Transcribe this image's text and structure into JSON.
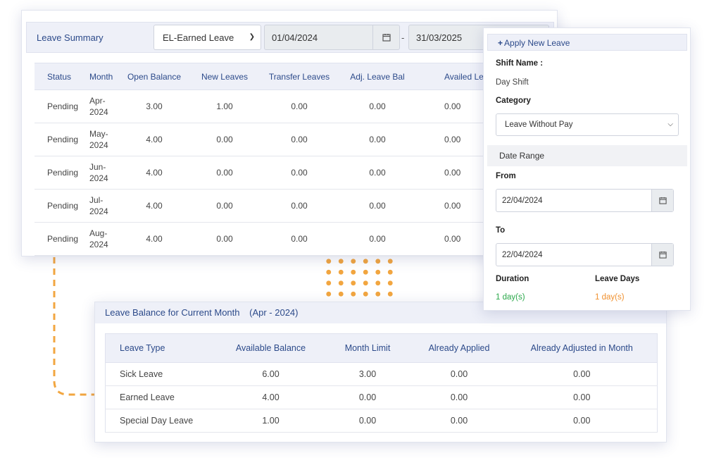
{
  "colors": {
    "accent": "#2c4a8a",
    "header_bg": "#eef0f8",
    "dash": "#f2a640",
    "green": "#2aa84a",
    "orange": "#f0902e"
  },
  "summary": {
    "title": "Leave Summary",
    "leave_type": "EL-Earned Leave",
    "date_from": "01/04/2024",
    "separator": "-",
    "date_to": "31/03/2025",
    "columns": [
      "Status",
      "Month",
      "Open Balance",
      "New Leaves",
      "Transfer Leaves",
      "Adj. Leave Bal",
      "Availed Lea"
    ],
    "rows": [
      {
        "status": "Pending",
        "month_a": "Apr-",
        "month_b": "2024",
        "open": "3.00",
        "new": "1.00",
        "transfer": "0.00",
        "adj": "0.00",
        "availed": "0.00"
      },
      {
        "status": "Pending",
        "month_a": "May-",
        "month_b": "2024",
        "open": "4.00",
        "new": "0.00",
        "transfer": "0.00",
        "adj": "0.00",
        "availed": "0.00"
      },
      {
        "status": "Pending",
        "month_a": "Jun-",
        "month_b": "2024",
        "open": "4.00",
        "new": "0.00",
        "transfer": "0.00",
        "adj": "0.00",
        "availed": "0.00"
      },
      {
        "status": "Pending",
        "month_a": "Jul-",
        "month_b": "2024",
        "open": "4.00",
        "new": "0.00",
        "transfer": "0.00",
        "adj": "0.00",
        "availed": "0.00"
      },
      {
        "status": "Pending",
        "month_a": "Aug-",
        "month_b": "2024",
        "open": "4.00",
        "new": "0.00",
        "transfer": "0.00",
        "adj": "0.00",
        "availed": "0.00"
      }
    ]
  },
  "apply": {
    "title": "Apply New Leave",
    "shift_label": "Shift Name :",
    "shift_value": "Day Shift",
    "category_label": "Category",
    "category_value": "Leave Without Pay",
    "date_range_label": "Date Range",
    "from_label": "From",
    "from_value": "22/04/2024",
    "to_label": "To",
    "to_value": "22/04/2024",
    "duration_label": "Duration",
    "duration_value": "1  day(s)",
    "leave_days_label": "Leave Days",
    "leave_days_value": "1  day(s)"
  },
  "balance": {
    "title": "Leave Balance for Current Month",
    "period": "(Apr - 2024)",
    "columns": [
      "Leave Type",
      "Available Balance",
      "Month Limit",
      "Already Applied",
      "Already Adjusted in Month"
    ],
    "rows": [
      {
        "type": "Sick Leave",
        "available": "6.00",
        "limit": "3.00",
        "applied": "0.00",
        "adjusted": "0.00"
      },
      {
        "type": "Earned Leave",
        "available": "4.00",
        "limit": "0.00",
        "applied": "0.00",
        "adjusted": "0.00"
      },
      {
        "type": "Special Day Leave",
        "available": "1.00",
        "limit": "0.00",
        "applied": "0.00",
        "adjusted": "0.00"
      }
    ]
  }
}
